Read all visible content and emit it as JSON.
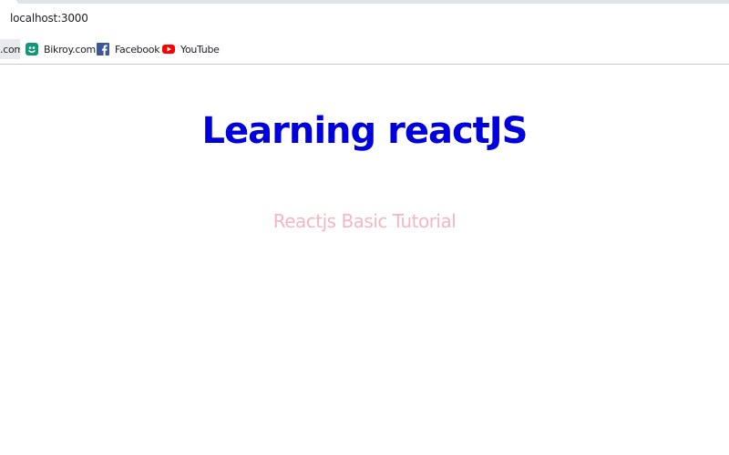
{
  "browser": {
    "url": "localhost:3000",
    "bookmarks": [
      {
        "label": ".com",
        "icon": "partial-favicon"
      },
      {
        "label": "Bikroy.com",
        "icon": "bikroy-icon",
        "color": "#149777"
      },
      {
        "label": "Facebook",
        "icon": "facebook-icon",
        "color": "#3b5998"
      },
      {
        "label": "YouTube",
        "icon": "youtube-icon",
        "color": "#ff0000"
      }
    ]
  },
  "page": {
    "heading": "Learning reactJS",
    "heading_color": "#0000dd",
    "subheading": "Reactjs Basic Tutorial",
    "subheading_color": "#f4b6c2"
  }
}
